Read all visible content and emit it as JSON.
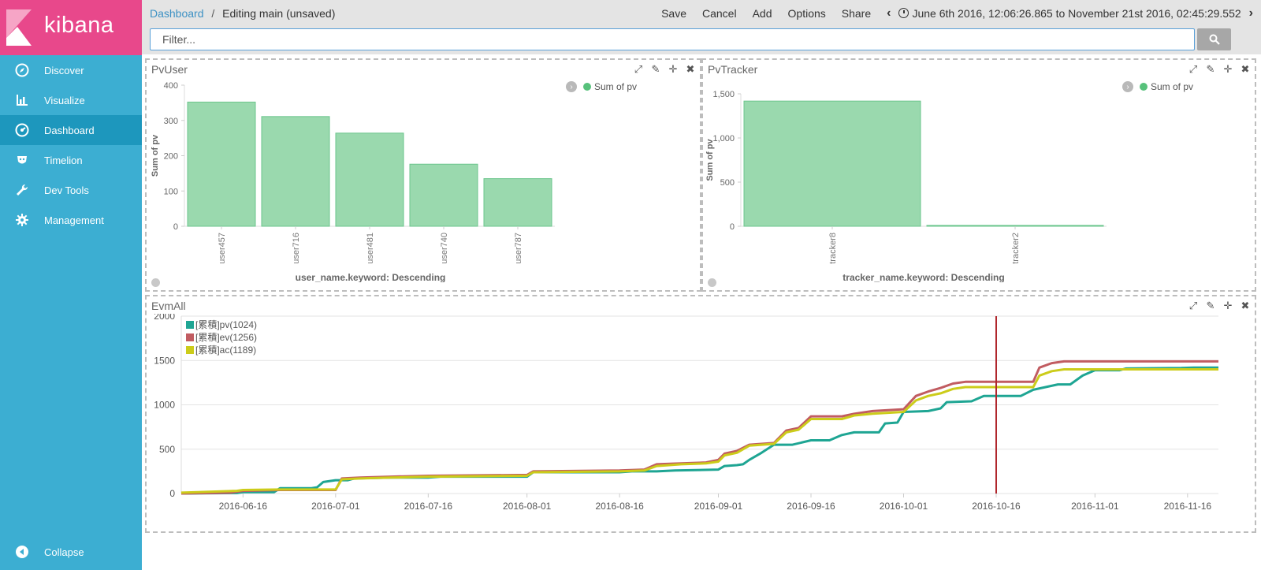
{
  "app": {
    "name": "kibana"
  },
  "sidebar": {
    "items": [
      {
        "label": "Discover",
        "icon": "compass-icon"
      },
      {
        "label": "Visualize",
        "icon": "bar-chart-icon"
      },
      {
        "label": "Dashboard",
        "icon": "dashboard-icon",
        "active": true
      },
      {
        "label": "Timelion",
        "icon": "timelion-icon"
      },
      {
        "label": "Dev Tools",
        "icon": "wrench-icon"
      },
      {
        "label": "Management",
        "icon": "gear-icon"
      }
    ],
    "collapse_label": "Collapse"
  },
  "topbar": {
    "breadcrumb_root": "Dashboard",
    "breadcrumb_sep": "/",
    "breadcrumb_current": "Editing main (unsaved)",
    "actions": {
      "save": "Save",
      "cancel": "Cancel",
      "add": "Add",
      "options": "Options",
      "share": "Share"
    },
    "time_range": "June 6th 2016, 12:06:26.865 to November 21st 2016, 02:45:29.552"
  },
  "search": {
    "placeholder": "Filter...",
    "value": ""
  },
  "colors": {
    "sidebar": "#3caed2",
    "logo": "#e8488b",
    "active_nav": "#1d97bd",
    "bar": "#9ad9ae",
    "legend_green": "#57c17b",
    "pv": "#1ea593",
    "ev": "#c15c61",
    "ac": "#cccc1a",
    "marker": "#b0272d"
  },
  "panels": {
    "pvuser": {
      "title": "PvUser",
      "legend": "Sum of pv",
      "chart_data": {
        "type": "bar",
        "categories": [
          "user457",
          "user716",
          "user481",
          "user740",
          "user787"
        ],
        "values": [
          352,
          311,
          264,
          176,
          135
        ],
        "ylabel": "Sum of pv",
        "xlabel": "user_name.keyword: Descending",
        "ylim": [
          0,
          400
        ],
        "yticks": [
          0,
          100,
          200,
          300,
          400
        ],
        "ytick_labels": [
          "0",
          "100",
          "200",
          "300",
          "400"
        ]
      }
    },
    "pvtracker": {
      "title": "PvTracker",
      "legend": "Sum of pv",
      "chart_data": {
        "type": "bar",
        "categories": [
          "tracker8",
          "tracker2"
        ],
        "values": [
          1418,
          10
        ],
        "ylabel": "Sum of pv",
        "xlabel": "tracker_name.keyword: Descending",
        "ylim": [
          0,
          1500
        ],
        "yticks": [
          0,
          500,
          1000,
          1500
        ],
        "ytick_labels": [
          "0",
          "500",
          "1,000",
          "1,500"
        ]
      }
    },
    "evmall": {
      "title": "EvmAll",
      "chart_data": {
        "type": "line",
        "x_range": [
          "2016-06-06",
          "2016-11-21"
        ],
        "xticks": [
          "2016-06-16",
          "2016-07-01",
          "2016-07-16",
          "2016-08-01",
          "2016-08-16",
          "2016-09-01",
          "2016-09-16",
          "2016-10-01",
          "2016-10-16",
          "2016-11-01",
          "2016-11-16"
        ],
        "ylim": [
          0,
          2000
        ],
        "yticks": [
          0,
          500,
          1000,
          1500,
          2000
        ],
        "marker_date": "2016-10-16",
        "series": [
          {
            "name": "[累積]pv(1024)",
            "color": "#1ea593",
            "points": [
              [
                "2016-06-06",
                0
              ],
              [
                "2016-06-15",
                5
              ],
              [
                "2016-06-16",
                15
              ],
              [
                "2016-06-21",
                15
              ],
              [
                "2016-06-22",
                60
              ],
              [
                "2016-06-27",
                60
              ],
              [
                "2016-06-28",
                70
              ],
              [
                "2016-06-29",
                130
              ],
              [
                "2016-07-01",
                150
              ],
              [
                "2016-07-03",
                150
              ],
              [
                "2016-07-04",
                170
              ],
              [
                "2016-07-10",
                180
              ],
              [
                "2016-07-16",
                180
              ],
              [
                "2016-07-18",
                190
              ],
              [
                "2016-08-01",
                190
              ],
              [
                "2016-08-02",
                240
              ],
              [
                "2016-08-16",
                240
              ],
              [
                "2016-08-18",
                250
              ],
              [
                "2016-08-22",
                250
              ],
              [
                "2016-08-25",
                260
              ],
              [
                "2016-09-01",
                270
              ],
              [
                "2016-09-02",
                310
              ],
              [
                "2016-09-04",
                320
              ],
              [
                "2016-09-05",
                330
              ],
              [
                "2016-09-06",
                380
              ],
              [
                "2016-09-08",
                460
              ],
              [
                "2016-09-10",
                550
              ],
              [
                "2016-09-13",
                550
              ],
              [
                "2016-09-16",
                600
              ],
              [
                "2016-09-19",
                600
              ],
              [
                "2016-09-21",
                660
              ],
              [
                "2016-09-23",
                690
              ],
              [
                "2016-09-27",
                690
              ],
              [
                "2016-09-28",
                790
              ],
              [
                "2016-09-30",
                800
              ],
              [
                "2016-10-01",
                920
              ],
              [
                "2016-10-05",
                930
              ],
              [
                "2016-10-07",
                960
              ],
              [
                "2016-10-08",
                1030
              ],
              [
                "2016-10-12",
                1040
              ],
              [
                "2016-10-14",
                1100
              ],
              [
                "2016-10-20",
                1100
              ],
              [
                "2016-10-22",
                1170
              ],
              [
                "2016-10-24",
                1200
              ],
              [
                "2016-10-26",
                1230
              ],
              [
                "2016-10-28",
                1230
              ],
              [
                "2016-10-30",
                1330
              ],
              [
                "2016-11-01",
                1390
              ],
              [
                "2016-11-05",
                1390
              ],
              [
                "2016-11-06",
                1410
              ],
              [
                "2016-11-15",
                1415
              ],
              [
                "2016-11-17",
                1420
              ],
              [
                "2016-11-21",
                1420
              ]
            ]
          },
          {
            "name": "[累積]ev(1256)",
            "color": "#c15c61",
            "points": [
              [
                "2016-06-06",
                0
              ],
              [
                "2016-06-14",
                10
              ],
              [
                "2016-06-16",
                30
              ],
              [
                "2016-06-22",
                40
              ],
              [
                "2016-07-01",
                40
              ],
              [
                "2016-07-02",
                170
              ],
              [
                "2016-07-05",
                180
              ],
              [
                "2016-07-10",
                190
              ],
              [
                "2016-07-16",
                200
              ],
              [
                "2016-08-01",
                210
              ],
              [
                "2016-08-02",
                250
              ],
              [
                "2016-08-16",
                260
              ],
              [
                "2016-08-20",
                270
              ],
              [
                "2016-08-22",
                330
              ],
              [
                "2016-08-26",
                340
              ],
              [
                "2016-08-30",
                350
              ],
              [
                "2016-09-01",
                380
              ],
              [
                "2016-09-02",
                450
              ],
              [
                "2016-09-04",
                480
              ],
              [
                "2016-09-06",
                550
              ],
              [
                "2016-09-10",
                570
              ],
              [
                "2016-09-12",
                710
              ],
              [
                "2016-09-14",
                740
              ],
              [
                "2016-09-16",
                870
              ],
              [
                "2016-09-21",
                870
              ],
              [
                "2016-09-23",
                900
              ],
              [
                "2016-09-26",
                930
              ],
              [
                "2016-10-01",
                950
              ],
              [
                "2016-10-03",
                1100
              ],
              [
                "2016-10-05",
                1150
              ],
              [
                "2016-10-07",
                1190
              ],
              [
                "2016-10-09",
                1240
              ],
              [
                "2016-10-11",
                1260
              ],
              [
                "2016-10-16",
                1260
              ],
              [
                "2016-10-22",
                1260
              ],
              [
                "2016-10-23",
                1420
              ],
              [
                "2016-10-25",
                1470
              ],
              [
                "2016-10-27",
                1490
              ],
              [
                "2016-11-21",
                1490
              ]
            ]
          },
          {
            "name": "[累積]ac(1189)",
            "color": "#cccc1a",
            "points": [
              [
                "2016-06-06",
                10
              ],
              [
                "2016-06-15",
                30
              ],
              [
                "2016-06-16",
                40
              ],
              [
                "2016-06-22",
                45
              ],
              [
                "2016-07-01",
                45
              ],
              [
                "2016-07-02",
                160
              ],
              [
                "2016-07-05",
                170
              ],
              [
                "2016-07-10",
                180
              ],
              [
                "2016-07-16",
                190
              ],
              [
                "2016-08-01",
                200
              ],
              [
                "2016-08-02",
                240
              ],
              [
                "2016-08-16",
                250
              ],
              [
                "2016-08-20",
                260
              ],
              [
                "2016-08-22",
                310
              ],
              [
                "2016-08-26",
                330
              ],
              [
                "2016-08-30",
                340
              ],
              [
                "2016-09-01",
                360
              ],
              [
                "2016-09-02",
                430
              ],
              [
                "2016-09-04",
                460
              ],
              [
                "2016-09-06",
                540
              ],
              [
                "2016-09-10",
                560
              ],
              [
                "2016-09-12",
                690
              ],
              [
                "2016-09-14",
                720
              ],
              [
                "2016-09-16",
                840
              ],
              [
                "2016-09-21",
                840
              ],
              [
                "2016-09-23",
                880
              ],
              [
                "2016-09-26",
                900
              ],
              [
                "2016-10-01",
                920
              ],
              [
                "2016-10-03",
                1050
              ],
              [
                "2016-10-05",
                1100
              ],
              [
                "2016-10-07",
                1130
              ],
              [
                "2016-10-09",
                1180
              ],
              [
                "2016-10-11",
                1200
              ],
              [
                "2016-10-22",
                1200
              ],
              [
                "2016-10-23",
                1330
              ],
              [
                "2016-10-25",
                1380
              ],
              [
                "2016-10-27",
                1400
              ],
              [
                "2016-11-21",
                1400
              ]
            ]
          }
        ]
      }
    }
  }
}
